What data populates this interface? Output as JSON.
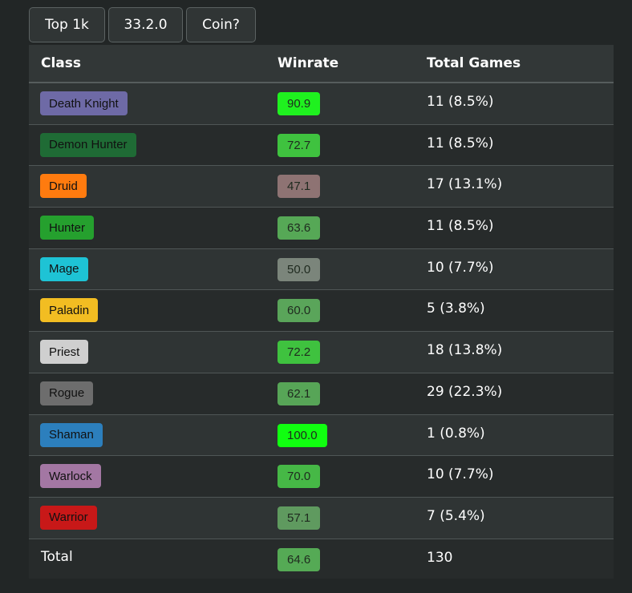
{
  "filters": [
    {
      "label": "Top 1k"
    },
    {
      "label": "33.2.0"
    },
    {
      "label": "Coin?"
    }
  ],
  "table": {
    "headers": {
      "class": "Class",
      "winrate": "Winrate",
      "total_games": "Total Games"
    },
    "rows": [
      {
        "class": "Death Knight",
        "class_color": "#6e6aa6",
        "winrate": "90.9",
        "winrate_color": "#1ff11f",
        "games": "11 (8.5%)"
      },
      {
        "class": "Demon Hunter",
        "class_color": "#1f6b35",
        "winrate": "72.7",
        "winrate_color": "#3fc23f",
        "games": "11 (8.5%)"
      },
      {
        "class": "Druid",
        "class_color": "#ff7b0f",
        "winrate": "47.1",
        "winrate_color": "#8e7373",
        "games": "17 (13.1%)"
      },
      {
        "class": "Hunter",
        "class_color": "#25a02e",
        "winrate": "63.6",
        "winrate_color": "#56a856",
        "games": "11 (8.5%)"
      },
      {
        "class": "Mage",
        "class_color": "#1ec3d5",
        "winrate": "50.0",
        "winrate_color": "#7b857b",
        "games": "10 (7.7%)"
      },
      {
        "class": "Paladin",
        "class_color": "#f2bd22",
        "winrate": "60.0",
        "winrate_color": "#5aa55a",
        "games": "5 (3.8%)"
      },
      {
        "class": "Priest",
        "class_color": "#cfcfcf",
        "winrate": "72.2",
        "winrate_color": "#3fc23f",
        "games": "18 (13.8%)"
      },
      {
        "class": "Rogue",
        "class_color": "#6d6d6d",
        "winrate": "62.1",
        "winrate_color": "#57a557",
        "games": "29 (22.3%)"
      },
      {
        "class": "Shaman",
        "class_color": "#2c7fbd",
        "winrate": "100.0",
        "winrate_color": "#10ff10",
        "games": "1 (0.8%)"
      },
      {
        "class": "Warlock",
        "class_color": "#a377a3",
        "winrate": "70.0",
        "winrate_color": "#46b846",
        "games": "10 (7.7%)"
      },
      {
        "class": "Warrior",
        "class_color": "#c81818",
        "winrate": "57.1",
        "winrate_color": "#5f9a5f",
        "games": "7 (5.4%)"
      }
    ],
    "total": {
      "label": "Total",
      "winrate": "64.6",
      "winrate_color": "#55aa55",
      "games": "130"
    }
  }
}
